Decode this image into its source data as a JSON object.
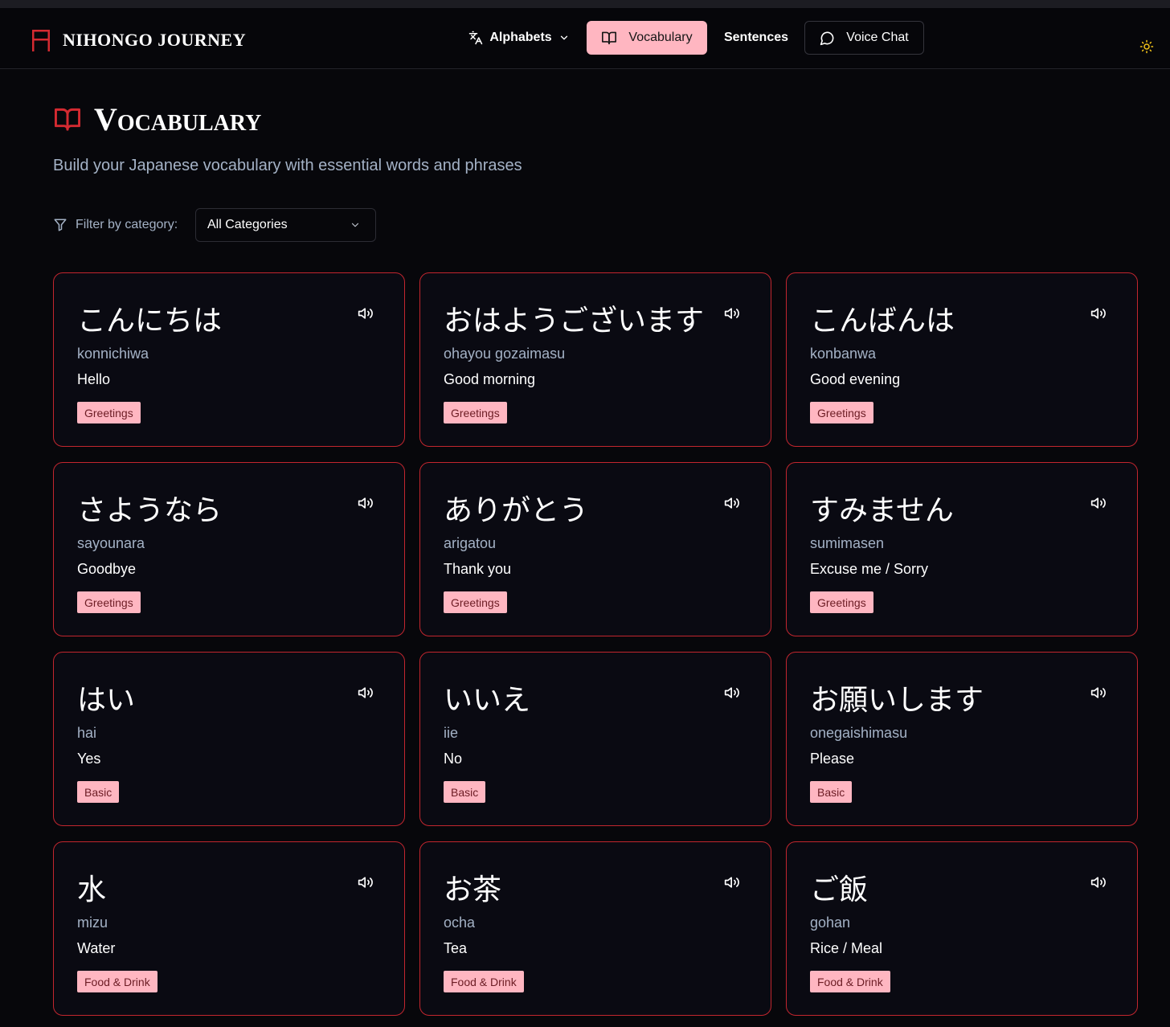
{
  "app": {
    "brand": "NIHONGO JOURNEY",
    "accent": "#ffb6c1",
    "card_border": "#c2262e",
    "brand_icon": "torii-icon"
  },
  "nav": {
    "alphabets": "Alphabets",
    "vocabulary": "Vocabulary",
    "sentences": "Sentences",
    "voice_chat": "Voice Chat"
  },
  "page": {
    "title": "Vocabulary",
    "subtitle": "Build your Japanese vocabulary with essential words and phrases"
  },
  "filter": {
    "label": "Filter by category:",
    "selected": "All Categories"
  },
  "cards": [
    {
      "jp": "こんにちは",
      "romaji": "konnichiwa",
      "meaning": "Hello",
      "category": "Greetings"
    },
    {
      "jp": "おはようございます",
      "romaji": "ohayou gozaimasu",
      "meaning": "Good morning",
      "category": "Greetings"
    },
    {
      "jp": "こんばんは",
      "romaji": "konbanwa",
      "meaning": "Good evening",
      "category": "Greetings"
    },
    {
      "jp": "さようなら",
      "romaji": "sayounara",
      "meaning": "Goodbye",
      "category": "Greetings"
    },
    {
      "jp": "ありがとう",
      "romaji": "arigatou",
      "meaning": "Thank you",
      "category": "Greetings"
    },
    {
      "jp": "すみません",
      "romaji": "sumimasen",
      "meaning": "Excuse me / Sorry",
      "category": "Greetings"
    },
    {
      "jp": "はい",
      "romaji": "hai",
      "meaning": "Yes",
      "category": "Basic"
    },
    {
      "jp": "いいえ",
      "romaji": "iie",
      "meaning": "No",
      "category": "Basic"
    },
    {
      "jp": "お願いします",
      "romaji": "onegaishimasu",
      "meaning": "Please",
      "category": "Basic"
    },
    {
      "jp": "水",
      "romaji": "mizu",
      "meaning": "Water",
      "category": "Food & Drink"
    },
    {
      "jp": "お茶",
      "romaji": "ocha",
      "meaning": "Tea",
      "category": "Food & Drink"
    },
    {
      "jp": "ご飯",
      "romaji": "gohan",
      "meaning": "Rice / Meal",
      "category": "Food & Drink"
    }
  ]
}
